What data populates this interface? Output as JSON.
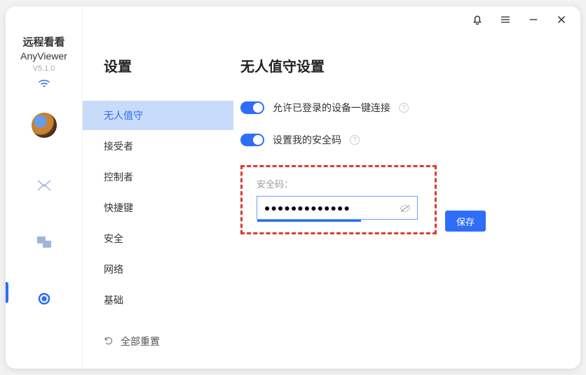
{
  "brand": {
    "cn": "远程看看",
    "en": "AnyViewer",
    "version": "V5.1.0"
  },
  "titlebar": {
    "bell": "bell-icon",
    "menu": "menu-icon",
    "min": "minimize-icon",
    "close": "close-icon"
  },
  "settings_title": "设置",
  "nav": {
    "items": [
      "无人值守",
      "接受者",
      "控制者",
      "快捷键",
      "安全",
      "网络",
      "基础"
    ],
    "selected": 0,
    "reset_label": "全部重置"
  },
  "panel": {
    "title": "无人值守设置",
    "toggle1_label": "允许已登录的设备一键连接",
    "toggle2_label": "设置我的安全码",
    "pwd_caption": "安全码：",
    "pwd_value": "●●●●●●●●●●●●●",
    "save_label": "保存",
    "help_char": "?"
  }
}
